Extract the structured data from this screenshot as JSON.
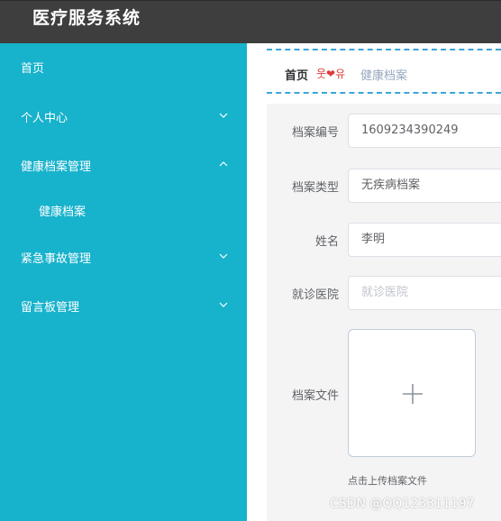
{
  "app": {
    "title": "医疗服务系统"
  },
  "colors": {
    "topbar": "#3e3e3e",
    "sidebar": "#17b2cc",
    "breadcrumb_border": "#3aa5dc",
    "accent_red": "#e03a3a"
  },
  "sidebar": {
    "items": [
      {
        "label": "首页",
        "icon": ""
      },
      {
        "label": "个人中心",
        "icon": "chevron-down-icon"
      },
      {
        "label": "健康档案管理",
        "icon": "chevron-up-icon"
      },
      {
        "label": "健康档案",
        "icon": ""
      },
      {
        "label": "紧急事故管理",
        "icon": "chevron-down-icon"
      },
      {
        "label": "留言板管理",
        "icon": "chevron-down-icon"
      }
    ]
  },
  "breadcrumb": {
    "home": "首页",
    "separator_left": "웃",
    "separator_heart": "❤",
    "separator_right": "유",
    "current": "健康档案"
  },
  "form": {
    "fields": [
      {
        "label": "档案编号",
        "value": "1609234390249",
        "placeholder": ""
      },
      {
        "label": "档案类型",
        "value": "无疾病档案",
        "placeholder": ""
      },
      {
        "label": "姓名",
        "value": "李明",
        "placeholder": ""
      },
      {
        "label": "就诊医院",
        "value": "",
        "placeholder": "就诊医院"
      }
    ],
    "upload": {
      "label": "档案文件",
      "tip": "点击上传档案文件",
      "icon": "plus-icon"
    }
  },
  "watermark": "CSDN @QQ123311197"
}
